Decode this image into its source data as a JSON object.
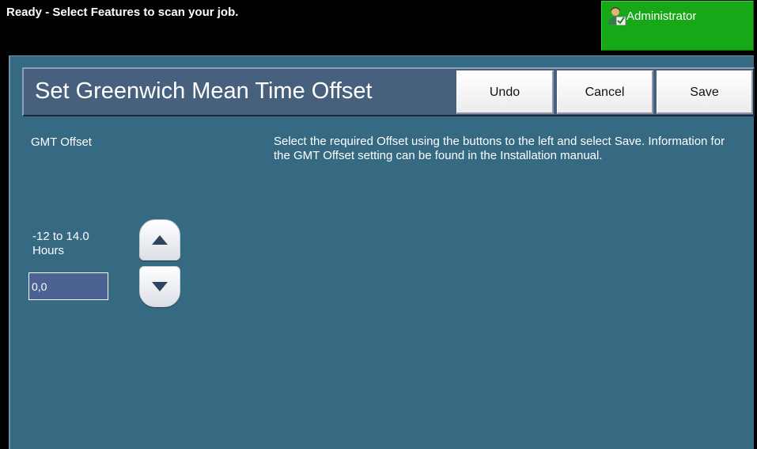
{
  "status_bar": {
    "message": "Ready - Select Features to scan your job.",
    "user_button_label": "Administrator",
    "user_icon": "administrator-icon",
    "user_button_color": "#17a817"
  },
  "header": {
    "title": "Set Greenwich Mean Time Offset",
    "undo_label": "Undo",
    "cancel_label": "Cancel",
    "save_label": "Save"
  },
  "main": {
    "offset_label": "GMT Offset",
    "instructions": "Select the required Offset using the buttons to the left and select Save. Information for the GMT Offset setting can be found in the Installation manual.",
    "range_line1": "-12 to 14.0",
    "range_line2": "Hours",
    "offset_value": "0,0",
    "increase_icon": "arrow-up-icon",
    "decrease_icon": "arrow-down-icon"
  },
  "colors": {
    "panel_background": "#356a82",
    "title_bar_background": "#46607e",
    "status_bar_background": "#000000"
  }
}
